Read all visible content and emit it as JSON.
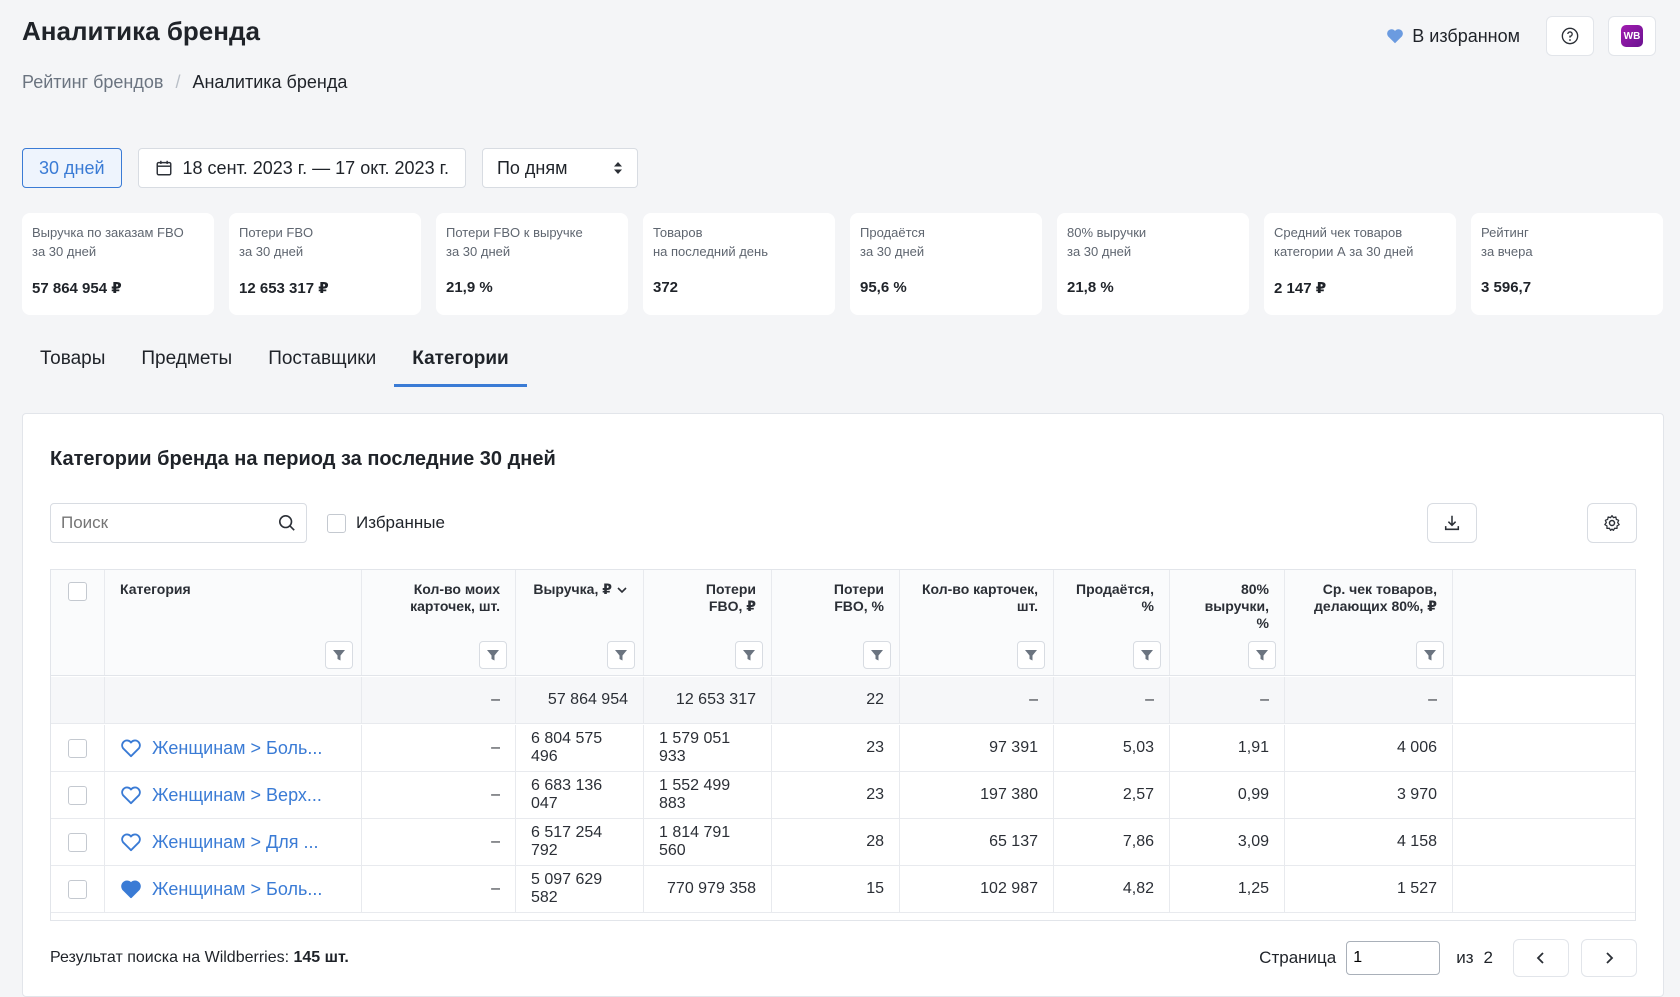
{
  "header": {
    "title": "Аналитика бренда",
    "favorite_label": "В избранном",
    "badge": "WB"
  },
  "breadcrumb": [
    {
      "label": "Рейтинг брендов"
    },
    {
      "label": "Аналитика бренда"
    }
  ],
  "controls": {
    "period": "30 дней",
    "date_range": "18 сент. 2023 г. — 17 окт. 2023 г.",
    "grouping": "По дням"
  },
  "cards": [
    {
      "l1": "Выручка по заказам FBO",
      "l2": "за 30 дней",
      "value": "57 864 954 ₽"
    },
    {
      "l1": "Потери FBO",
      "l2": "за 30 дней",
      "value": "12 653 317 ₽"
    },
    {
      "l1": "Потери FBO к выручке",
      "l2": "за 30 дней",
      "value": "21,9 %"
    },
    {
      "l1": "Товаров",
      "l2": "на последний день",
      "value": "372"
    },
    {
      "l1": "Продаётся",
      "l2": "за 30 дней",
      "value": "95,6 %"
    },
    {
      "l1": "80% выручки",
      "l2": "за 30 дней",
      "value": "21,8 %"
    },
    {
      "l1": "Средний чек товаров",
      "l2": "категории А за 30 дней",
      "value": "2 147 ₽"
    },
    {
      "l1": "Рейтинг",
      "l2": "за вчера",
      "value": "3 596,7"
    }
  ],
  "tabs": [
    {
      "label": "Товары"
    },
    {
      "label": "Предметы"
    },
    {
      "label": "Поставщики"
    },
    {
      "label": "Категории"
    }
  ],
  "panel": {
    "title": "Категории бренда на период за последние 30 дней",
    "search_placeholder": "Поиск",
    "favorites_label": "Избранные"
  },
  "table": {
    "columns": [
      "Категория",
      "Кол-во моих карточек, шт.",
      "Выручка, ₽",
      "Потери FBO, ₽",
      "Потери FBO, %",
      "Кол-во карточек, шт.",
      "Продаётся, %",
      "80% выручки, %",
      "Ср. чек товаров, делающих 80%, ₽"
    ],
    "total": [
      "–",
      "57 864 954",
      "12 653 317",
      "22",
      "–",
      "–",
      "–",
      "–"
    ],
    "rows": [
      {
        "category": "Женщинам > Боль...",
        "fav": false,
        "vals": [
          "–",
          "6 804 575 496",
          "1 579 051 933",
          "23",
          "97 391",
          "5,03",
          "1,91",
          "4 006"
        ]
      },
      {
        "category": "Женщинам > Верх...",
        "fav": false,
        "vals": [
          "–",
          "6 683 136 047",
          "1 552 499 883",
          "23",
          "197 380",
          "2,57",
          "0,99",
          "3 970"
        ]
      },
      {
        "category": "Женщинам > Для ...",
        "fav": false,
        "vals": [
          "–",
          "6 517 254 792",
          "1 814 791 560",
          "28",
          "65 137",
          "7,86",
          "3,09",
          "4 158"
        ]
      },
      {
        "category": "Женщинам > Боль...",
        "fav": true,
        "vals": [
          "–",
          "5 097 629 582",
          "770 979 358",
          "15",
          "102 987",
          "4,82",
          "1,25",
          "1 527"
        ]
      }
    ]
  },
  "footer": {
    "result_label": "Результат поиска на Wildberries:",
    "result_count": "145 шт.",
    "page_label": "Страница",
    "page_value": "1",
    "of_label": "из",
    "total_pages": "2"
  },
  "colors": {
    "accent": "#3a7bd5",
    "heart_filled": "#3a7bd5"
  }
}
